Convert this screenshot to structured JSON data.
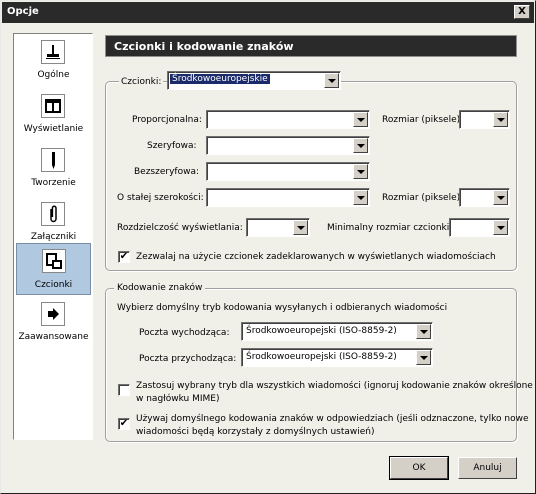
{
  "window": {
    "title": "Opcje",
    "close_glyph": "X"
  },
  "sidebar": {
    "items": [
      {
        "label": "Ogólne",
        "icon": "stamp-icon",
        "selected": false
      },
      {
        "label": "Wyświetlanie",
        "icon": "window-icon",
        "selected": false
      },
      {
        "label": "Tworzenie",
        "icon": "pen-icon",
        "selected": false
      },
      {
        "label": "Załączniki",
        "icon": "paperclip-icon",
        "selected": false
      },
      {
        "label": "Czcionki",
        "icon": "fonts-icon",
        "selected": true
      },
      {
        "label": "Zaawansowane",
        "icon": "arrow-right-icon",
        "selected": false
      }
    ]
  },
  "header": {
    "title": "Czcionki i kodowanie znaków"
  },
  "fonts_group": {
    "charset_label": "Czcionki:",
    "charset_value": "Środkowoeuropejskie",
    "proportional_label": "Proporcjonalna:",
    "proportional_value": "",
    "size_label_1": "Rozmiar (piksele)",
    "size_value_1": "",
    "serif_label": "Szeryfowa:",
    "serif_value": "",
    "sans_label": "Bezszeryfowa:",
    "sans_value": "",
    "monospace_label": "O stałej szerokości:",
    "monospace_value": "",
    "size_label_2": "Rozmiar (piksele)",
    "size_value_2": "",
    "resolution_label": "Rozdzielczość wyświetlania:",
    "resolution_value": "",
    "min_size_label": "Minimalny rozmiar czcionki:",
    "min_size_value": "",
    "allow_fonts_label": "Zezwalaj na użycie czcionek zadeklarowanych w wyświetlanych wiadomościach",
    "allow_fonts_checked": "✔"
  },
  "encoding_group": {
    "legend": "Kodowanie znaków",
    "description": "Wybierz domyślny tryb kodowania wysyłanych i odbieranych wiadomości",
    "outgoing_label": "Poczta wychodząca:",
    "outgoing_value": "Środkowoeuropejski (ISO-8859-2)",
    "incoming_label": "Poczta przychodząca:",
    "incoming_value": "Środkowoeuropejski (ISO-8859-2)",
    "apply_all_label_1": "Zastosuj wybrany tryb dla wszystkich wiadomości (ignoruj kodowanie znaków określone",
    "apply_all_label_2": "w nagłówku MIME)",
    "apply_all_checked": "",
    "use_default_label_1": "Używaj domyślnego kodowania znaków w odpowiedziach (jeśli odznaczone, tylko nowe",
    "use_default_label_2": "wiadomości będą korzystały z domyślnych ustawień)",
    "use_default_checked": "✔"
  },
  "buttons": {
    "ok": "OK",
    "cancel": "Anuluj"
  }
}
